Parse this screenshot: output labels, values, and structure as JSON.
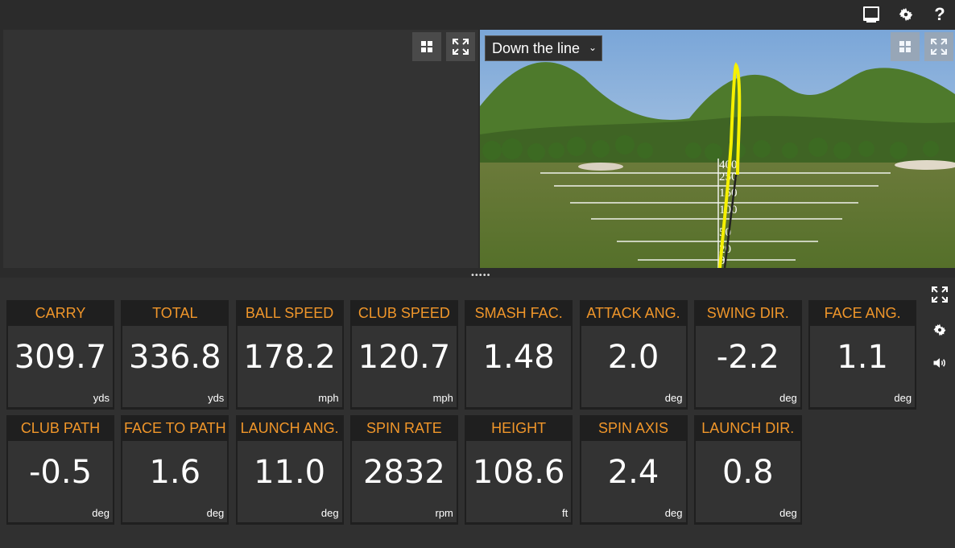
{
  "top_icons": [
    "display-icon",
    "gear-icon",
    "help-icon"
  ],
  "help_label": "?",
  "view_select": {
    "value": "Down the line"
  },
  "yardage_markers": [
    "400",
    "250",
    "150",
    "100",
    "50",
    "20",
    "0"
  ],
  "colors": {
    "accent": "#f0962a",
    "trace": "#f5f000",
    "tile_bg": "#333333"
  },
  "metrics": [
    {
      "label": "CARRY",
      "value": "309.7",
      "unit": "yds"
    },
    {
      "label": "TOTAL",
      "value": "336.8",
      "unit": "yds"
    },
    {
      "label": "BALL SPEED",
      "value": "178.2",
      "unit": "mph"
    },
    {
      "label": "CLUB SPEED",
      "value": "120.7",
      "unit": "mph"
    },
    {
      "label": "SMASH FAC.",
      "value": "1.48",
      "unit": ""
    },
    {
      "label": "ATTACK ANG.",
      "value": "2.0",
      "unit": "deg"
    },
    {
      "label": "SWING DIR.",
      "value": "-2.2",
      "unit": "deg"
    },
    {
      "label": "FACE ANG.",
      "value": "1.1",
      "unit": "deg"
    },
    {
      "label": "CLUB PATH",
      "value": "-0.5",
      "unit": "deg"
    },
    {
      "label": "FACE TO PATH",
      "value": "1.6",
      "unit": "deg"
    },
    {
      "label": "LAUNCH ANG.",
      "value": "11.0",
      "unit": "deg"
    },
    {
      "label": "SPIN RATE",
      "value": "2832",
      "unit": "rpm"
    },
    {
      "label": "HEIGHT",
      "value": "108.6",
      "unit": "ft"
    },
    {
      "label": "SPIN AXIS",
      "value": "2.4",
      "unit": "deg"
    },
    {
      "label": "LAUNCH DIR.",
      "value": "0.8",
      "unit": "deg"
    }
  ]
}
